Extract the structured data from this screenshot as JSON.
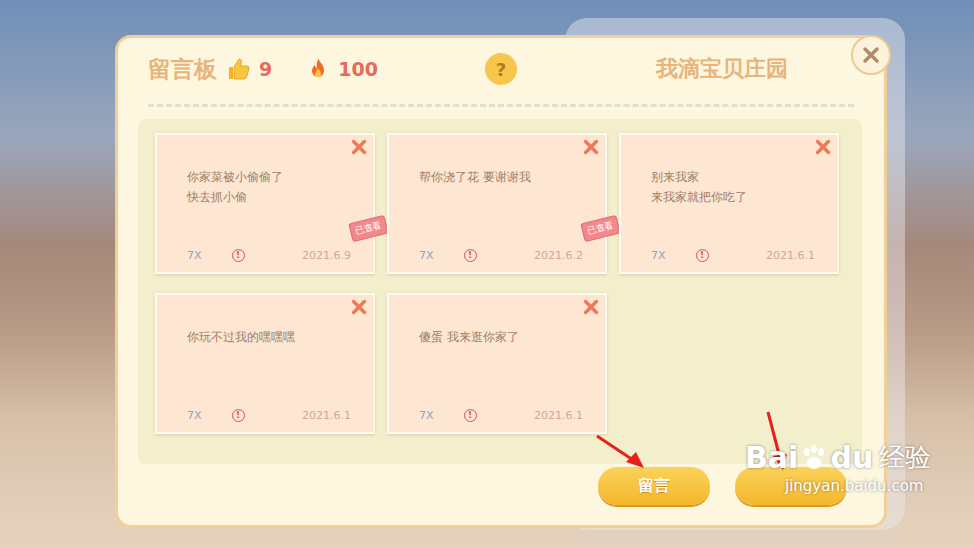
{
  "board": {
    "title": "留言板",
    "likes": "9",
    "heat": "100",
    "help": "?",
    "farm_name": "我滴宝贝庄园",
    "viewed_label": "已查看",
    "report_icon": "!"
  },
  "messages": [
    {
      "lines": [
        "你家菜被小偷偷了",
        "快去抓小偷"
      ],
      "author": "7X",
      "date": "2021.6.9",
      "viewed": true
    },
    {
      "lines": [
        "帮你浇了花 要谢谢我"
      ],
      "author": "7X",
      "date": "2021.6.2",
      "viewed": true
    },
    {
      "lines": [
        "别来我家",
        "来我家就把你吃了"
      ],
      "author": "7X",
      "date": "2021.6.1",
      "viewed": false
    },
    {
      "lines": [
        "你玩不过我的嘿嘿嘿"
      ],
      "author": "7X",
      "date": "2021.6.1",
      "viewed": false
    },
    {
      "lines": [
        "傻蛋 我来逛你家了"
      ],
      "author": "7X",
      "date": "2021.6.1",
      "viewed": false
    }
  ],
  "buttons": [
    {
      "label": "留言"
    },
    {
      "label": ""
    }
  ],
  "watermark": {
    "brand_a": "Bai",
    "brand_b": "du",
    "suffix": "经验",
    "url": "jingyan.baidu.com"
  }
}
